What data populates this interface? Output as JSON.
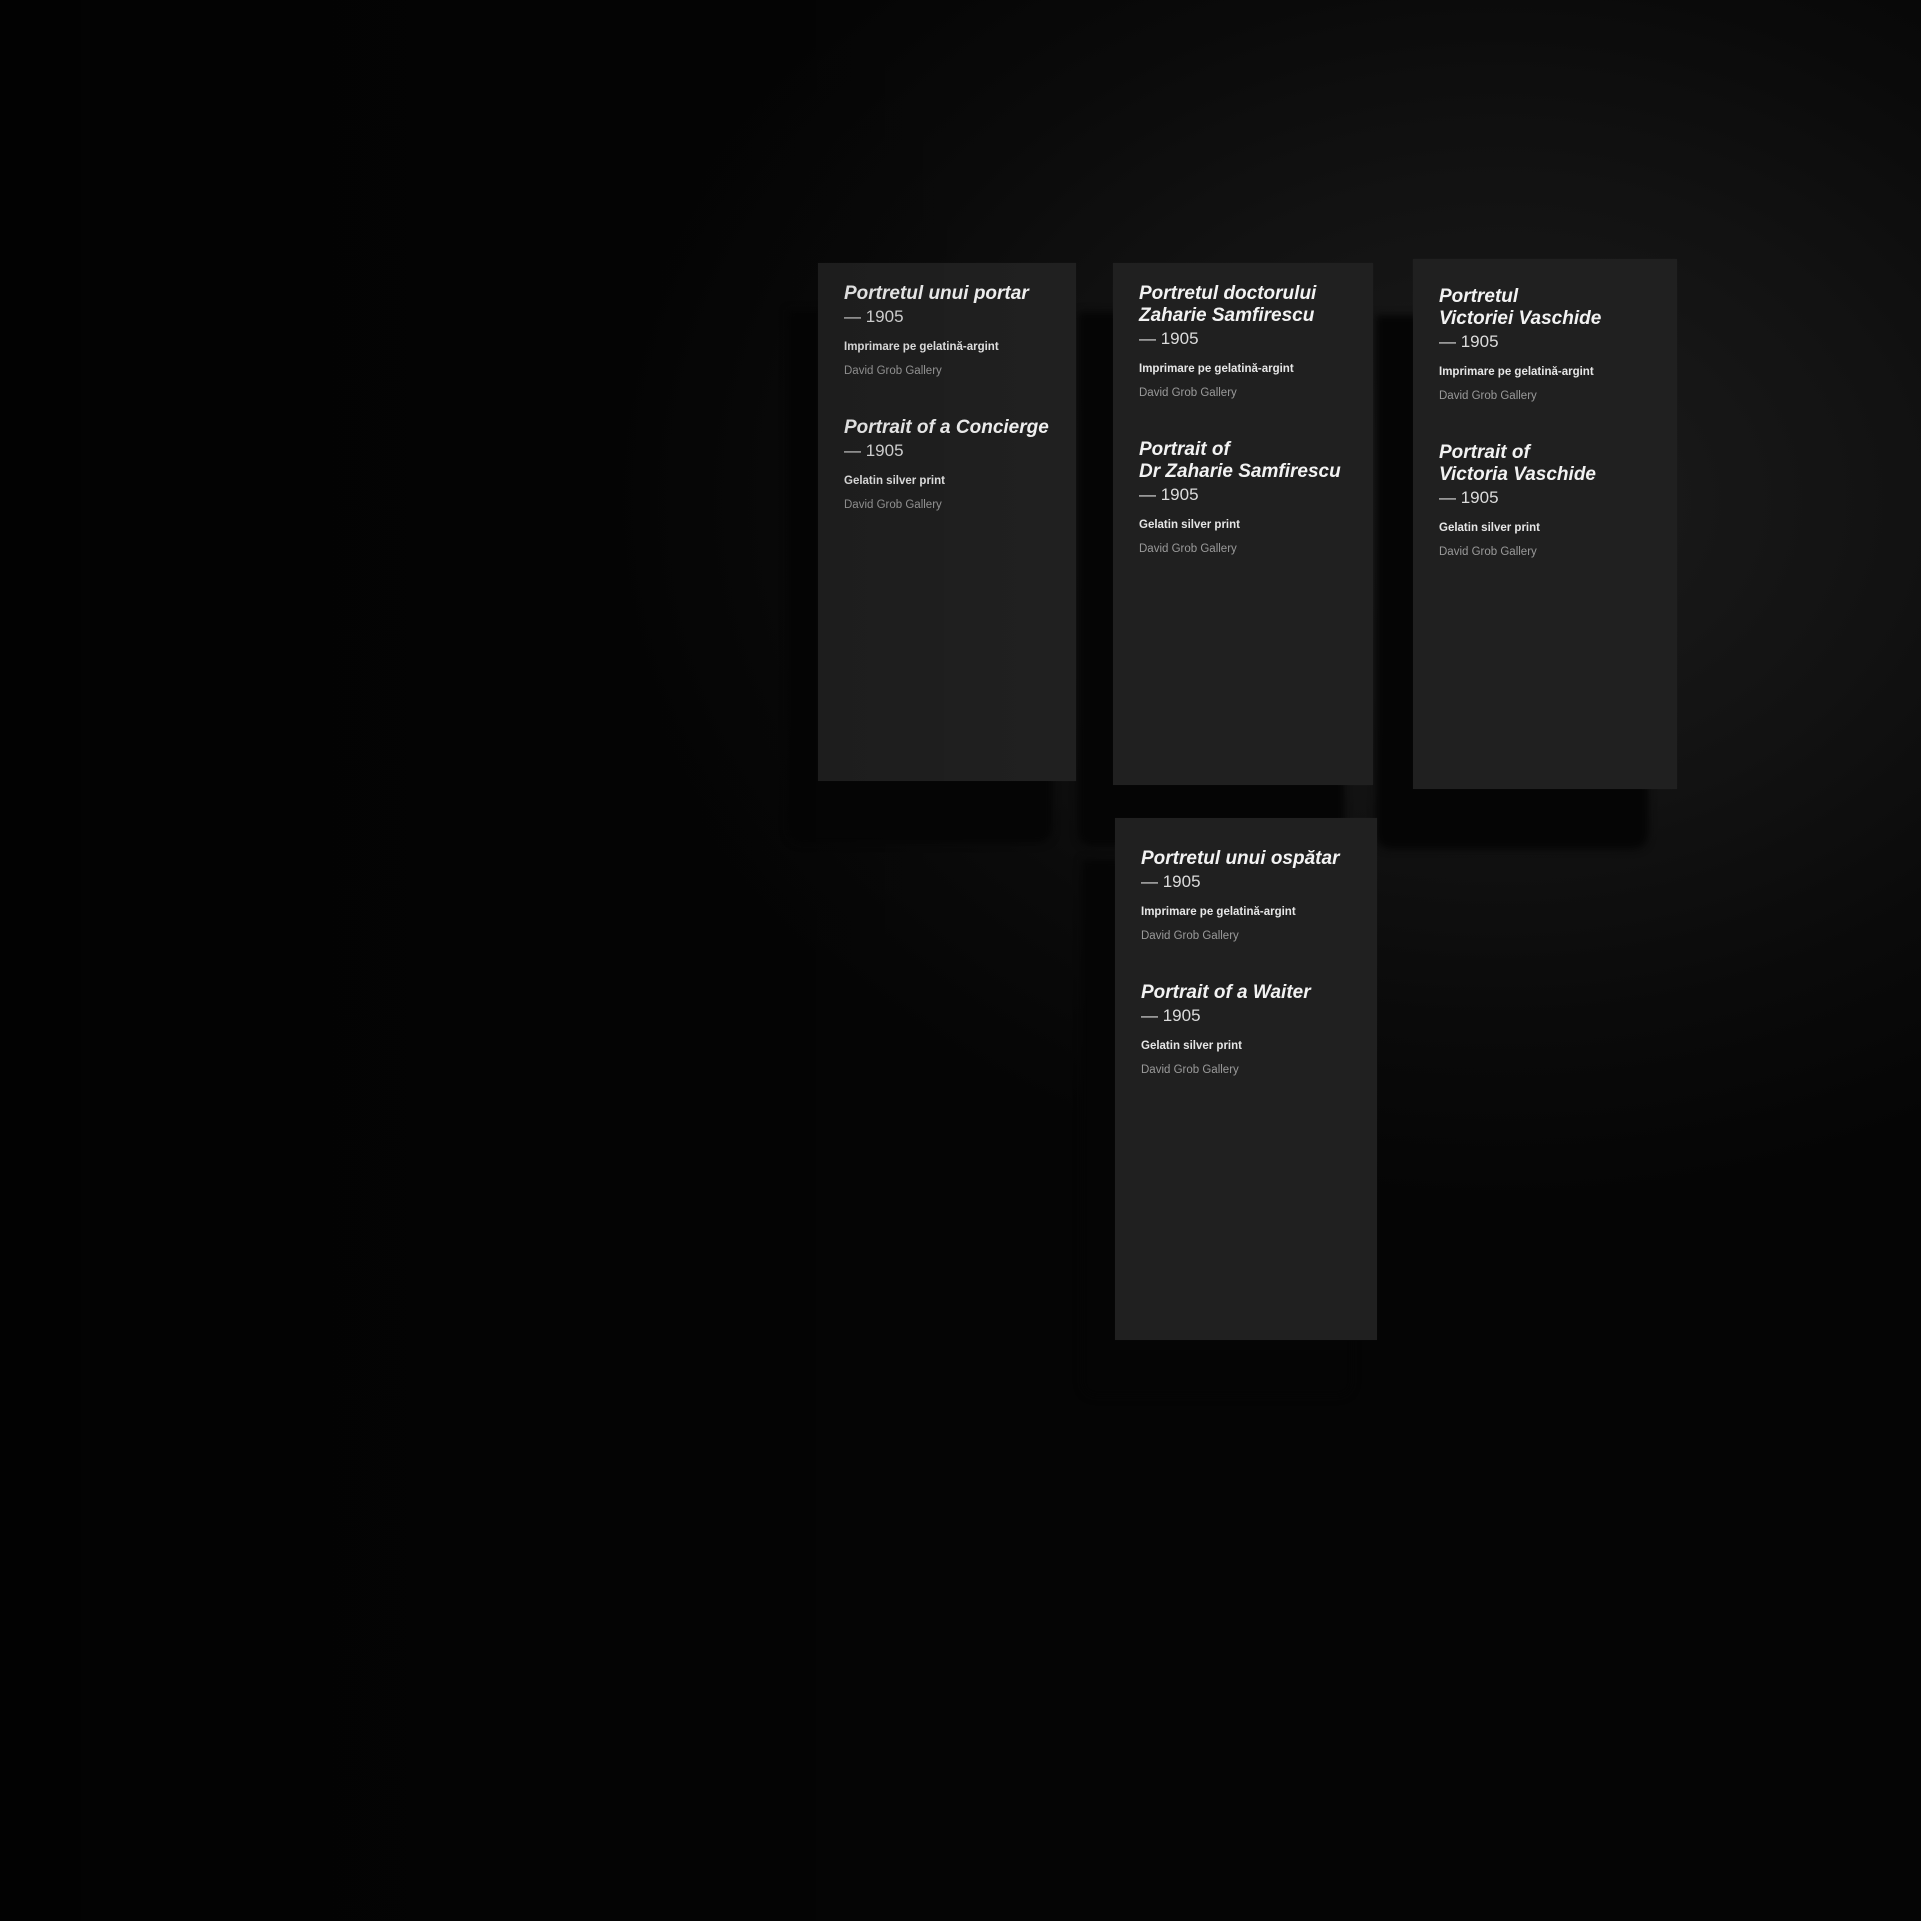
{
  "labels": [
    {
      "ro": {
        "title": "Portretul unui portar",
        "year": "— 1905",
        "medium": "Imprimare pe gelatină-argint",
        "gallery": "David Grob Gallery"
      },
      "en": {
        "title": "Portrait of a Concierge",
        "year": "— 1905",
        "medium": "Gelatin silver print",
        "gallery": "David Grob Gallery"
      }
    },
    {
      "ro": {
        "title": "Portretul doctorului\nZaharie Samfirescu",
        "year": "— 1905",
        "medium": "Imprimare pe gelatină-argint",
        "gallery": "David Grob Gallery"
      },
      "en": {
        "title": "Portrait of\nDr Zaharie Samfirescu",
        "year": "— 1905",
        "medium": "Gelatin silver print",
        "gallery": "David Grob Gallery"
      }
    },
    {
      "ro": {
        "title": "Portretul\nVictoriei Vaschide",
        "year": "— 1905",
        "medium": "Imprimare pe gelatină-argint",
        "gallery": "David Grob Gallery"
      },
      "en": {
        "title": "Portrait of\nVictoria Vaschide",
        "year": "— 1905",
        "medium": "Gelatin silver print",
        "gallery": "David Grob Gallery"
      }
    },
    {
      "ro": {
        "title": "Portretul unui ospătar",
        "year": "— 1905",
        "medium": "Imprimare pe gelatină-argint",
        "gallery": "David Grob Gallery"
      },
      "en": {
        "title": "Portrait of a Waiter",
        "year": "— 1905",
        "medium": "Gelatin silver print",
        "gallery": "David Grob Gallery"
      }
    }
  ]
}
